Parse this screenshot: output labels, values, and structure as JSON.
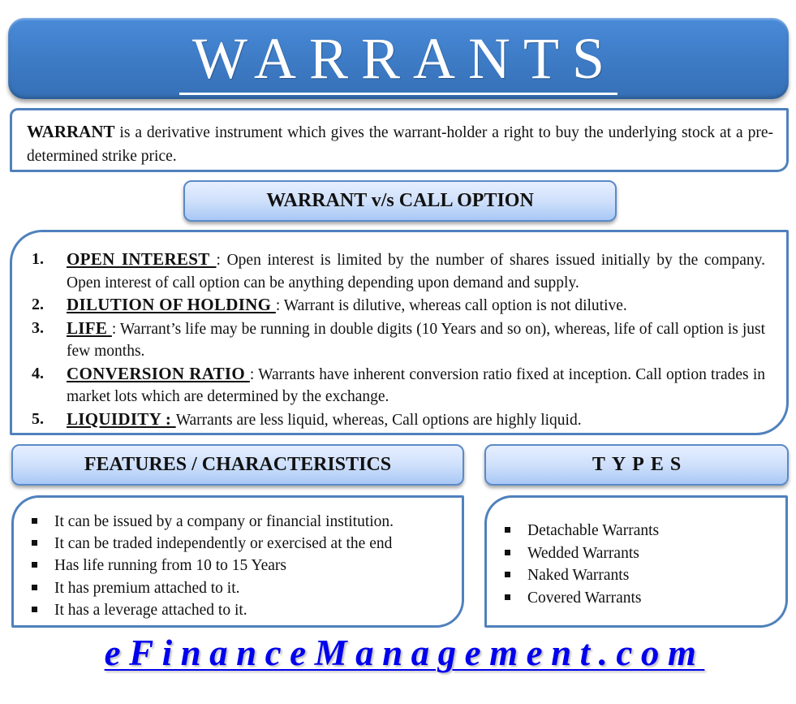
{
  "title": "WARRANTS",
  "definition": {
    "term": "WARRANT",
    "text": " is a derivative instrument which gives the warrant-holder a right to buy the underlying stock at a pre-determined strike price."
  },
  "comparison": {
    "header": "WARRANT v/s CALL OPTION",
    "items": [
      {
        "number": "1.",
        "term": "OPEN INTEREST ",
        "text": ": Open interest is limited by the number of shares issued initially by the company. Open interest of call option can be anything depending upon demand and supply."
      },
      {
        "number": "2.",
        "term": "DILUTION OF HOLDING ",
        "text": ": Warrant is dilutive, whereas call option is not dilutive."
      },
      {
        "number": "3.",
        "term": "LIFE ",
        "text": ": Warrant’s life may be running in double digits (10 Years and so on), whereas, life of call option is just few months."
      },
      {
        "number": "4.",
        "term": "CONVERSION RATIO ",
        "text": ": Warrants have inherent conversion ratio fixed at inception. Call option trades in market lots which are determined by the exchange."
      },
      {
        "number": "5.",
        "term": "LIQUIDITY : ",
        "text": "Warrants are less liquid, whereas, Call options are highly liquid."
      }
    ]
  },
  "features": {
    "header": "FEATURES / CHARACTERISTICS",
    "items": [
      "It can be issued by a company or financial institution.",
      "It can be traded independently or exercised at the end",
      "Has life running from 10 to 15 Years",
      "It has premium attached to it.",
      "It has a leverage attached to it."
    ]
  },
  "types": {
    "header": "TYPES",
    "items": [
      "Detachable Warrants",
      "Wedded Warrants",
      "Naked Warrants",
      "Covered Warrants"
    ]
  },
  "footer": {
    "link_text": "eFinanceManagement.com"
  },
  "colors": {
    "banner_blue": "#3f7dc8",
    "border_blue": "#4f81bd",
    "header_light_blue": "#cfe0fb",
    "link_blue": "#0000ee"
  }
}
